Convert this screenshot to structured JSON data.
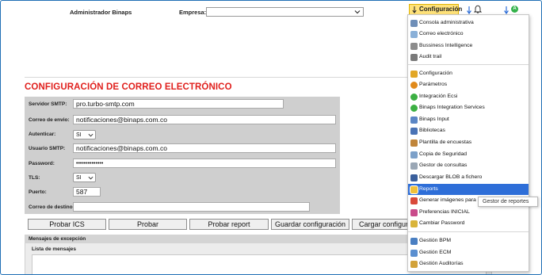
{
  "header": {
    "user_label": "Administrador Binaps",
    "empresa_label": "Empresa:",
    "empresa_value": "",
    "config_button_label": "Configuración",
    "avatar_letter": "A",
    "accent_color": "#ffe27a",
    "avatar_color": "#34b24a"
  },
  "page": {
    "title": "CONFIGURACIÓN DE CORREO ELECTRÓNICO",
    "title_color": "#e0201d"
  },
  "form": {
    "servidor_label": "Servidor SMTP:",
    "servidor_value": "pro.turbo-smtp.com",
    "correo_envio_label": "Correo de envio:",
    "correo_envio_value": "notificaciones@binaps.com.co",
    "autenticar_label": "Autenticar:",
    "autenticar_value": "SI",
    "usuario_label": "Usuario SMTP:",
    "usuario_value": "notificaciones@binaps.com.co",
    "password_label": "Password:",
    "password_value": "••••••••••••••",
    "tls_label": "TLS:",
    "tls_value": "SI",
    "puerto_label": "Puerto:",
    "puerto_value": "587",
    "destino_label": "Correo de destino:",
    "destino_value": ""
  },
  "buttons": {
    "probar_ics": "Probar ICS",
    "probar": "Probar",
    "probar_report": "Probar report",
    "guardar": "Guardar configuración",
    "cargar": "Cargar configuración"
  },
  "exceptions": {
    "section_title": "Mensajes de excepción",
    "list_title": "Lista de mensajes"
  },
  "menu": {
    "items": [
      {
        "label": "Consola administrativa",
        "icon": "console-icon",
        "color": "#6f8fb8"
      },
      {
        "label": "Correo electrónico",
        "icon": "email-icon",
        "color": "#8ab0d8"
      },
      {
        "label": "Bussiness Intelligence",
        "icon": "bi-chart-icon",
        "color": "#8c8c8c"
      },
      {
        "label": "Audit trail",
        "icon": "audit-icon",
        "color": "#7a7a7a"
      },
      {
        "label": "Configuración",
        "icon": "config-gears-icon",
        "color": "#e2a726"
      },
      {
        "label": "Parámetros",
        "icon": "parameters-icon",
        "color": "#e08a1c"
      },
      {
        "label": "Integración Ecsi",
        "icon": "integration-icon",
        "color": "#3cb043"
      },
      {
        "label": "Binaps Integration Services",
        "icon": "integration-services-icon",
        "color": "#3cb043"
      },
      {
        "label": "Binaps Input",
        "icon": "input-icon",
        "color": "#5b86c5"
      },
      {
        "label": "Bibliotecas",
        "icon": "library-icon",
        "color": "#4a73b5"
      },
      {
        "label": "Plantilla de encuestas",
        "icon": "survey-icon",
        "color": "#c0853a"
      },
      {
        "label": "Copia de Seguridad",
        "icon": "backup-icon",
        "color": "#7da1c9"
      },
      {
        "label": "Gestor de consultas",
        "icon": "query-icon",
        "color": "#9aa7b5"
      },
      {
        "label": "Descargar BLOB a fichero",
        "icon": "download-blob-icon",
        "color": "#3a5f9c"
      },
      {
        "label": "Reports",
        "icon": "reports-icon",
        "color": "#f0c03a"
      },
      {
        "label": "Generar imágenes para PDF",
        "icon": "pdf-images-icon",
        "color": "#d94a3a"
      },
      {
        "label": "Preferencias INICIAL",
        "icon": "preferences-icon",
        "color": "#c94b8b"
      },
      {
        "label": "Cambiar Password",
        "icon": "key-icon",
        "color": "#d9b43a"
      },
      {
        "label": "Gestión BPM",
        "icon": "bpm-icon",
        "color": "#4a7fc2"
      },
      {
        "label": "Gestión ECM",
        "icon": "ecm-icon",
        "color": "#5a8fd0"
      },
      {
        "label": "Gestión Auditorías",
        "icon": "audits-icon",
        "color": "#d2a23a"
      }
    ],
    "active_index": 14,
    "active_color": "#2e6ed8"
  },
  "tooltip": {
    "text": "Gestor de reportes"
  }
}
